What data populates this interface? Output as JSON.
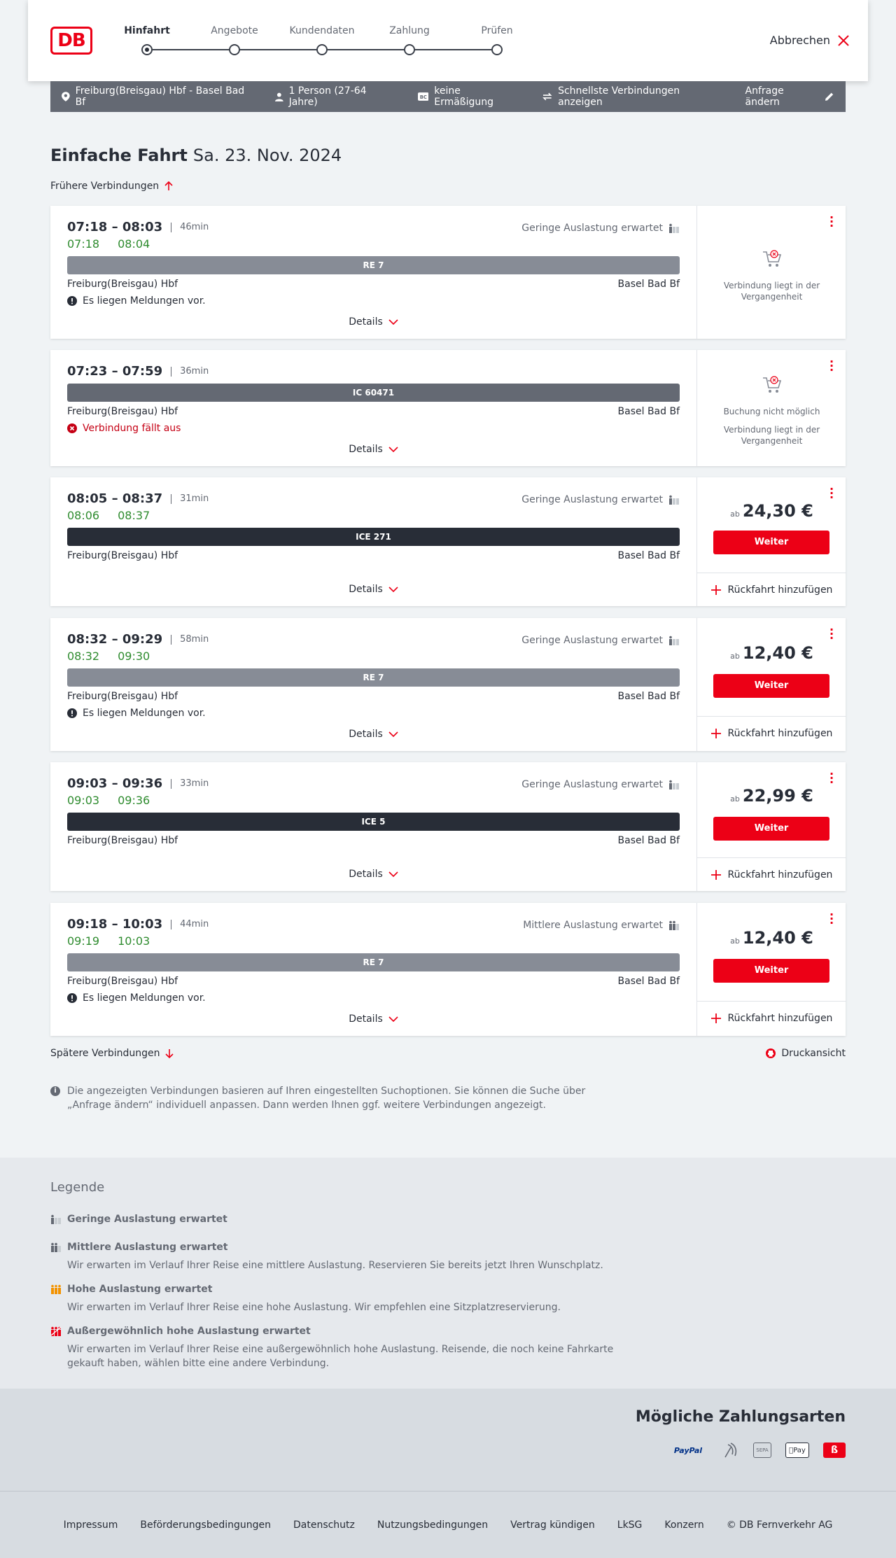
{
  "header": {
    "logo": "DB",
    "steps": [
      {
        "label": "Hinfahrt",
        "active": true
      },
      {
        "label": "Angebote",
        "active": false
      },
      {
        "label": "Kundendaten",
        "active": false
      },
      {
        "label": "Zahlung",
        "active": false
      },
      {
        "label": "Prüfen",
        "active": false
      }
    ],
    "cancel_label": "Abbrechen"
  },
  "query": {
    "route": "Freiburg(Breisgau) Hbf - Basel Bad Bf",
    "persons": "1 Person (27-64 Jahre)",
    "discount": "keine Ermäßigung",
    "fastest": "Schnellste Verbindungen anzeigen",
    "change": "Anfrage ändern"
  },
  "page": {
    "title": "Einfache Fahrt",
    "date": "Sa. 23. Nov. 2024",
    "earlier": "Frühere Verbindungen",
    "later": "Spätere Verbindungen",
    "print": "Druckansicht",
    "info": "Die angezeigten Verbindungen basieren auf Ihren eingestellten Suchoptionen. Sie können die Suche über „Anfrage ändern“ individuell anpassen. Dann werden Ihnen ggf. weitere Verbindungen angezeigt."
  },
  "common": {
    "details": "Details",
    "weiter": "Weiter",
    "ab": "ab",
    "return": "Rückfahrt hinzufügen",
    "past": "Verbindung liegt in der Vergangenheit",
    "not_possible": "Buchung nicht möglich"
  },
  "connections": [
    {
      "times": "07:18 – 08:03",
      "duration": "46min",
      "rt_dep": "07:18",
      "rt_arr": "08:04",
      "load": "Geringe Auslastung erwartet",
      "train": "RE 7",
      "from": "Freiburg(Breisgau) Hbf",
      "to": "Basel Bad Bf",
      "message": "Es liegen Meldungen vor."
    },
    {
      "times": "07:23 – 07:59",
      "duration": "36min",
      "train": "IC 60471",
      "from": "Freiburg(Breisgau) Hbf",
      "to": "Basel Bad Bf",
      "message": "Verbindung fällt aus"
    },
    {
      "times": "08:05 – 08:37",
      "duration": "31min",
      "rt_dep": "08:06",
      "rt_arr": "08:37",
      "load": "Geringe Auslastung erwartet",
      "train": "ICE 271",
      "from": "Freiburg(Breisgau) Hbf",
      "to": "Basel Bad Bf",
      "price": "24,30 €"
    },
    {
      "times": "08:32 – 09:29",
      "duration": "58min",
      "rt_dep": "08:32",
      "rt_arr": "09:30",
      "load": "Geringe Auslastung erwartet",
      "train": "RE 7",
      "from": "Freiburg(Breisgau) Hbf",
      "to": "Basel Bad Bf",
      "message": "Es liegen Meldungen vor.",
      "price": "12,40 €"
    },
    {
      "times": "09:03 – 09:36",
      "duration": "33min",
      "rt_dep": "09:03",
      "rt_arr": "09:36",
      "load": "Geringe Auslastung erwartet",
      "train": "ICE 5",
      "from": "Freiburg(Breisgau) Hbf",
      "to": "Basel Bad Bf",
      "price": "22,99 €"
    },
    {
      "times": "09:18 – 10:03",
      "duration": "44min",
      "rt_dep": "09:19",
      "rt_arr": "10:03",
      "load": "Mittlere Auslastung erwartet",
      "train": "RE 7",
      "from": "Freiburg(Breisgau) Hbf",
      "to": "Basel Bad Bf",
      "message": "Es liegen Meldungen vor.",
      "price": "12,40 €"
    }
  ],
  "legend": {
    "title": "Legende",
    "items": [
      {
        "head": "Geringe Auslastung erwartet",
        "desc": ""
      },
      {
        "head": "Mittlere Auslastung erwartet",
        "desc": "Wir erwarten im Verlauf Ihrer Reise eine mittlere Auslastung. Reservieren Sie bereits jetzt Ihren Wunschplatz."
      },
      {
        "head": "Hohe Auslastung erwartet",
        "desc": "Wir erwarten im Verlauf Ihrer Reise eine hohe Auslastung. Wir empfehlen eine Sitzplatzreservierung."
      },
      {
        "head": "Außergewöhnlich hohe Auslastung erwartet",
        "desc": "Wir erwarten im Verlauf Ihrer Reise eine außergewöhnlich hohe Auslastung. Reisende, die noch keine Fahrkarte gekauft haben, wählen bitte eine andere Verbindung."
      }
    ]
  },
  "payment": {
    "title": "Mögliche Zahlungsarten",
    "paypal": "PayPal",
    "sepa": "SEPA",
    "applepay": "Pay"
  },
  "footer": {
    "links": [
      "Impressum",
      "Beförderungsbedingungen",
      "Datenschutz",
      "Nutzungsbedingungen",
      "Vertrag kündigen",
      "LkSG",
      "Konzern",
      "© DB Fernverkehr AG"
    ]
  },
  "colors": {
    "accent": "#ec0016",
    "realtime": "#2e8b2e",
    "dark": "#282d37"
  }
}
